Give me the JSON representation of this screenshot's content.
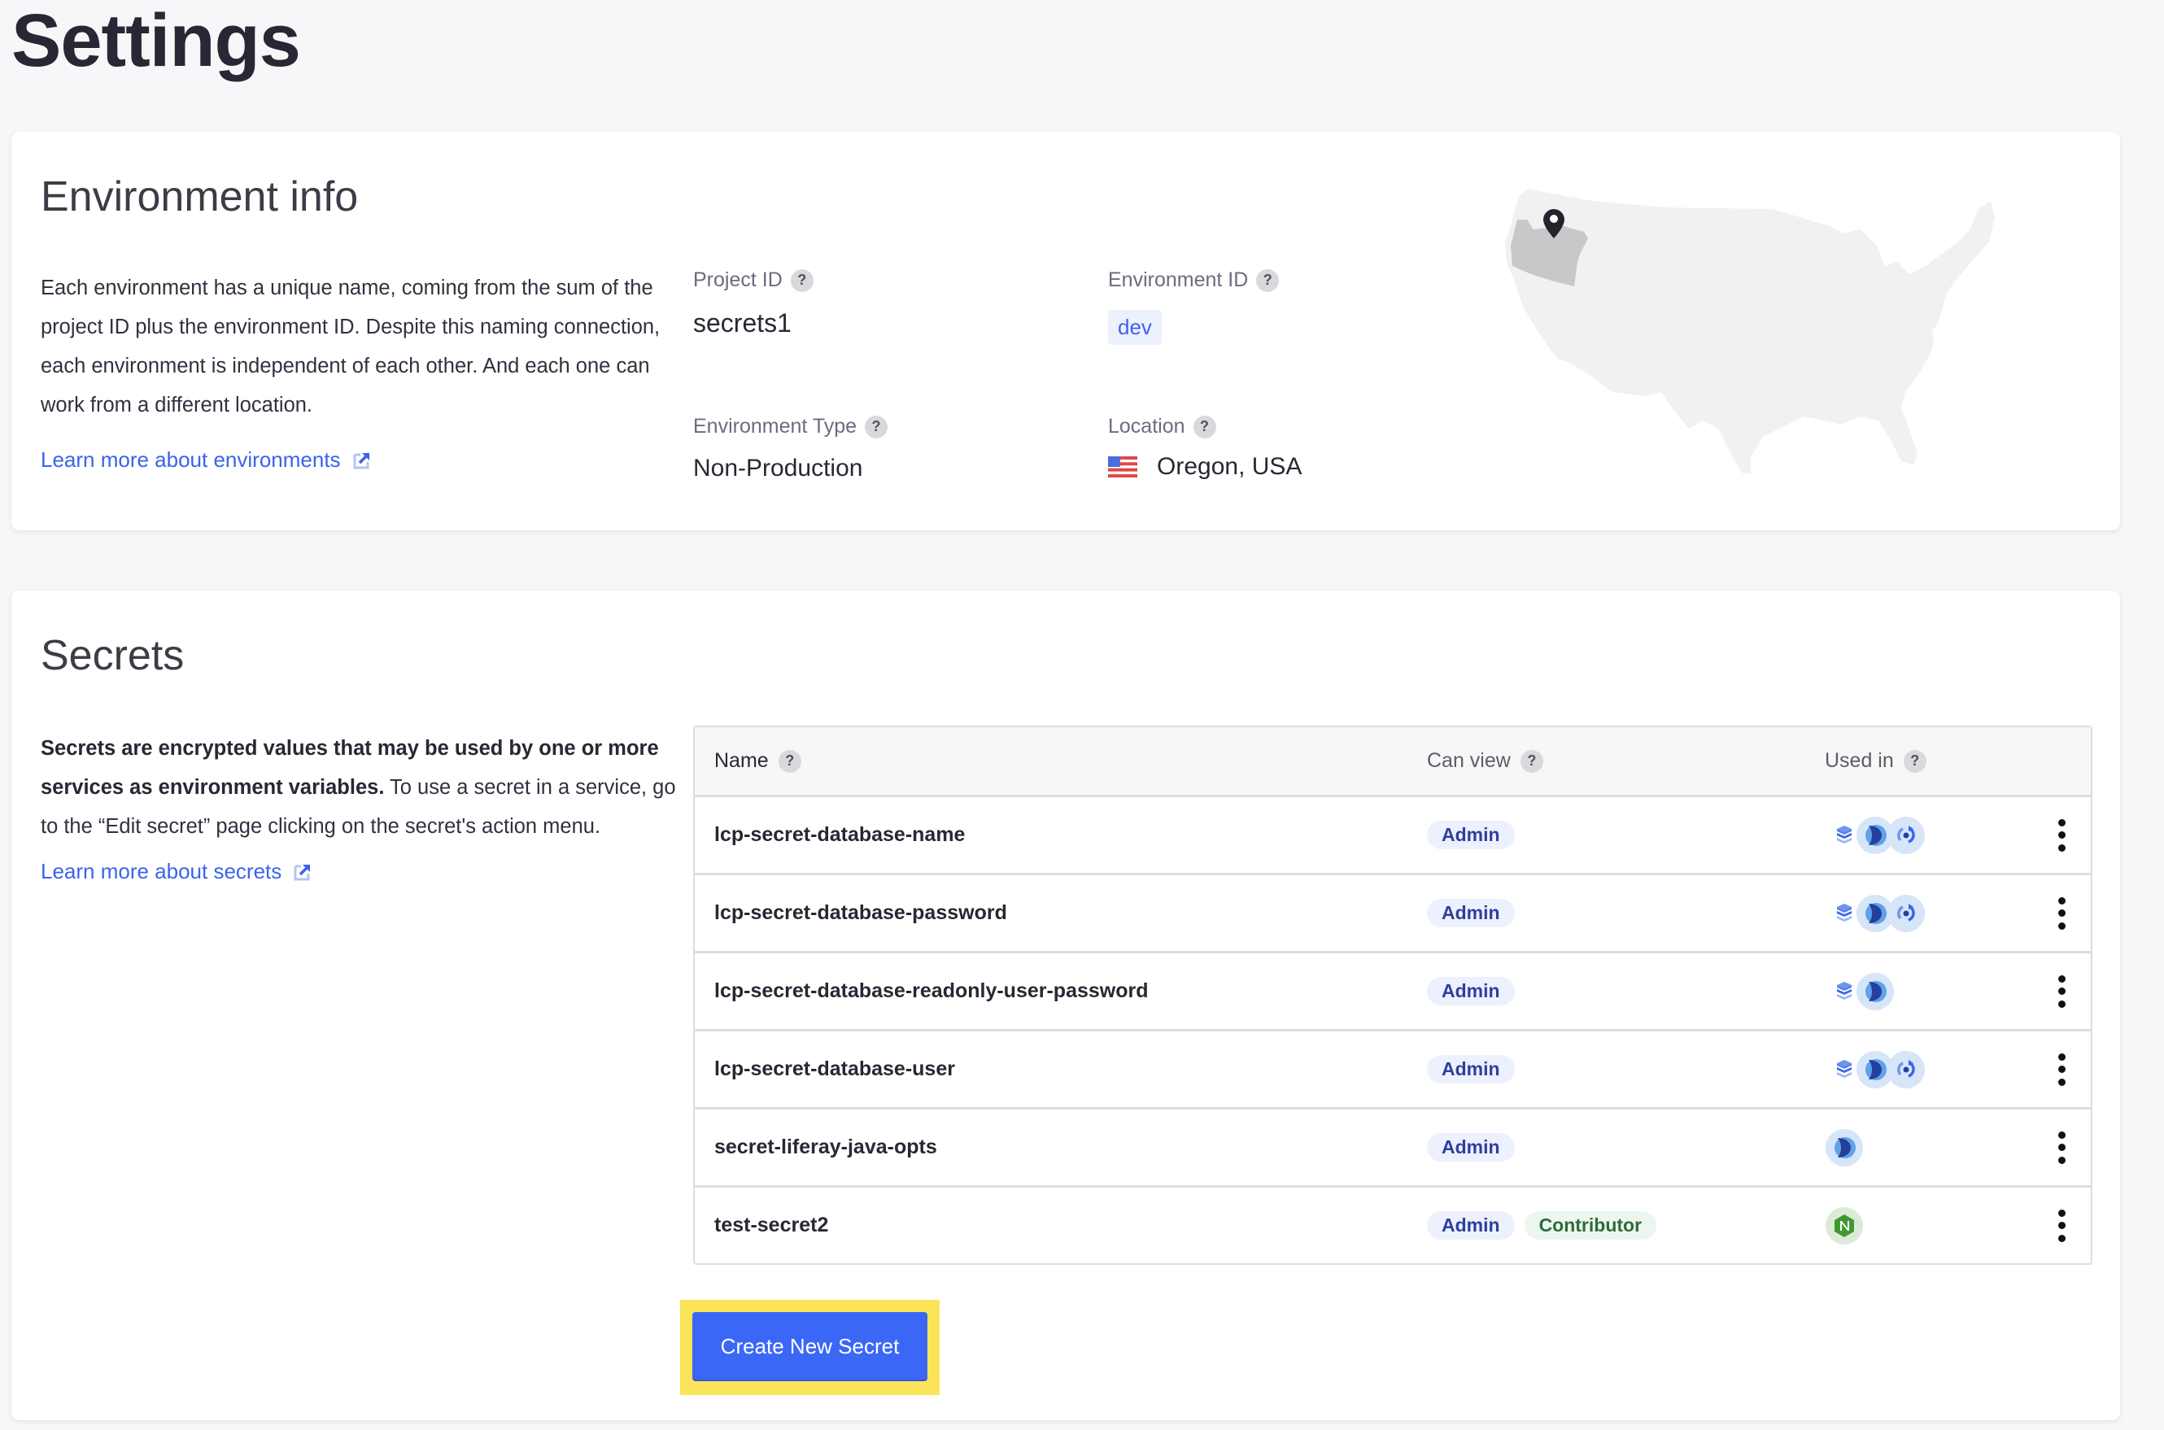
{
  "page": {
    "title": "Settings"
  },
  "environment_info": {
    "title": "Environment info",
    "description": "Each environment has a unique name, coming from the sum of the project ID plus the environment ID. Despite this naming connection, each environment is independent of each other. And each one can work from a different location.",
    "learn_more_label": "Learn more about environments",
    "learn_more_icon": "external-link-icon",
    "fields": {
      "project_id": {
        "label": "Project ID",
        "value": "secrets1",
        "help_icon": "?"
      },
      "environment_id": {
        "label": "Environment ID",
        "value": "dev",
        "help_icon": "?"
      },
      "environment_type": {
        "label": "Environment Type",
        "value": "Non-Production",
        "help_icon": "?"
      },
      "location": {
        "label": "Location",
        "value": "Oregon, USA",
        "flag_icon": "us-flag-icon",
        "help_icon": "?"
      }
    },
    "map": {
      "region": "USA",
      "highlighted_state": "Oregon",
      "marker_icon": "map-pin-icon"
    }
  },
  "secrets": {
    "title": "Secrets",
    "description_bold": "Secrets are encrypted values that may be used by one or more services as environment variables.",
    "description_rest": " To use a secret in a service, go to the “Edit secret” page clicking on the secret's action menu.",
    "learn_more_label": "Learn more about secrets",
    "learn_more_icon": "external-link-icon",
    "table": {
      "columns": [
        {
          "label": "Name",
          "help_icon": "?"
        },
        {
          "label": "Can view",
          "help_icon": "?"
        },
        {
          "label": "Used in",
          "help_icon": "?"
        }
      ],
      "rows": [
        {
          "name": "lcp-secret-database-name",
          "roles": [
            "Admin"
          ],
          "used_in": [
            "database",
            "liferay",
            "backup"
          ]
        },
        {
          "name": "lcp-secret-database-password",
          "roles": [
            "Admin"
          ],
          "used_in": [
            "database",
            "liferay",
            "backup"
          ]
        },
        {
          "name": "lcp-secret-database-readonly-user-password",
          "roles": [
            "Admin"
          ],
          "used_in": [
            "database",
            "liferay"
          ]
        },
        {
          "name": "lcp-secret-database-user",
          "roles": [
            "Admin"
          ],
          "used_in": [
            "database",
            "liferay",
            "backup"
          ]
        },
        {
          "name": "secret-liferay-java-opts",
          "roles": [
            "Admin"
          ],
          "used_in": [
            "liferay"
          ]
        },
        {
          "name": "test-secret2",
          "roles": [
            "Admin",
            "Contributor"
          ],
          "used_in": [
            "nginx"
          ]
        }
      ],
      "row_action_icon": "kebab-menu-icon"
    },
    "create_button_label": "Create New Secret"
  },
  "colors": {
    "accent": "#3b67f7",
    "link": "#3a63ec",
    "highlight": "#fce45a",
    "admin_badge_bg": "#edf0fd",
    "admin_badge_text": "#2e3f9c",
    "contributor_badge_bg": "#edf6ee",
    "contributor_badge_text": "#2e6b3a",
    "page_bg": "#f6f7f9"
  }
}
